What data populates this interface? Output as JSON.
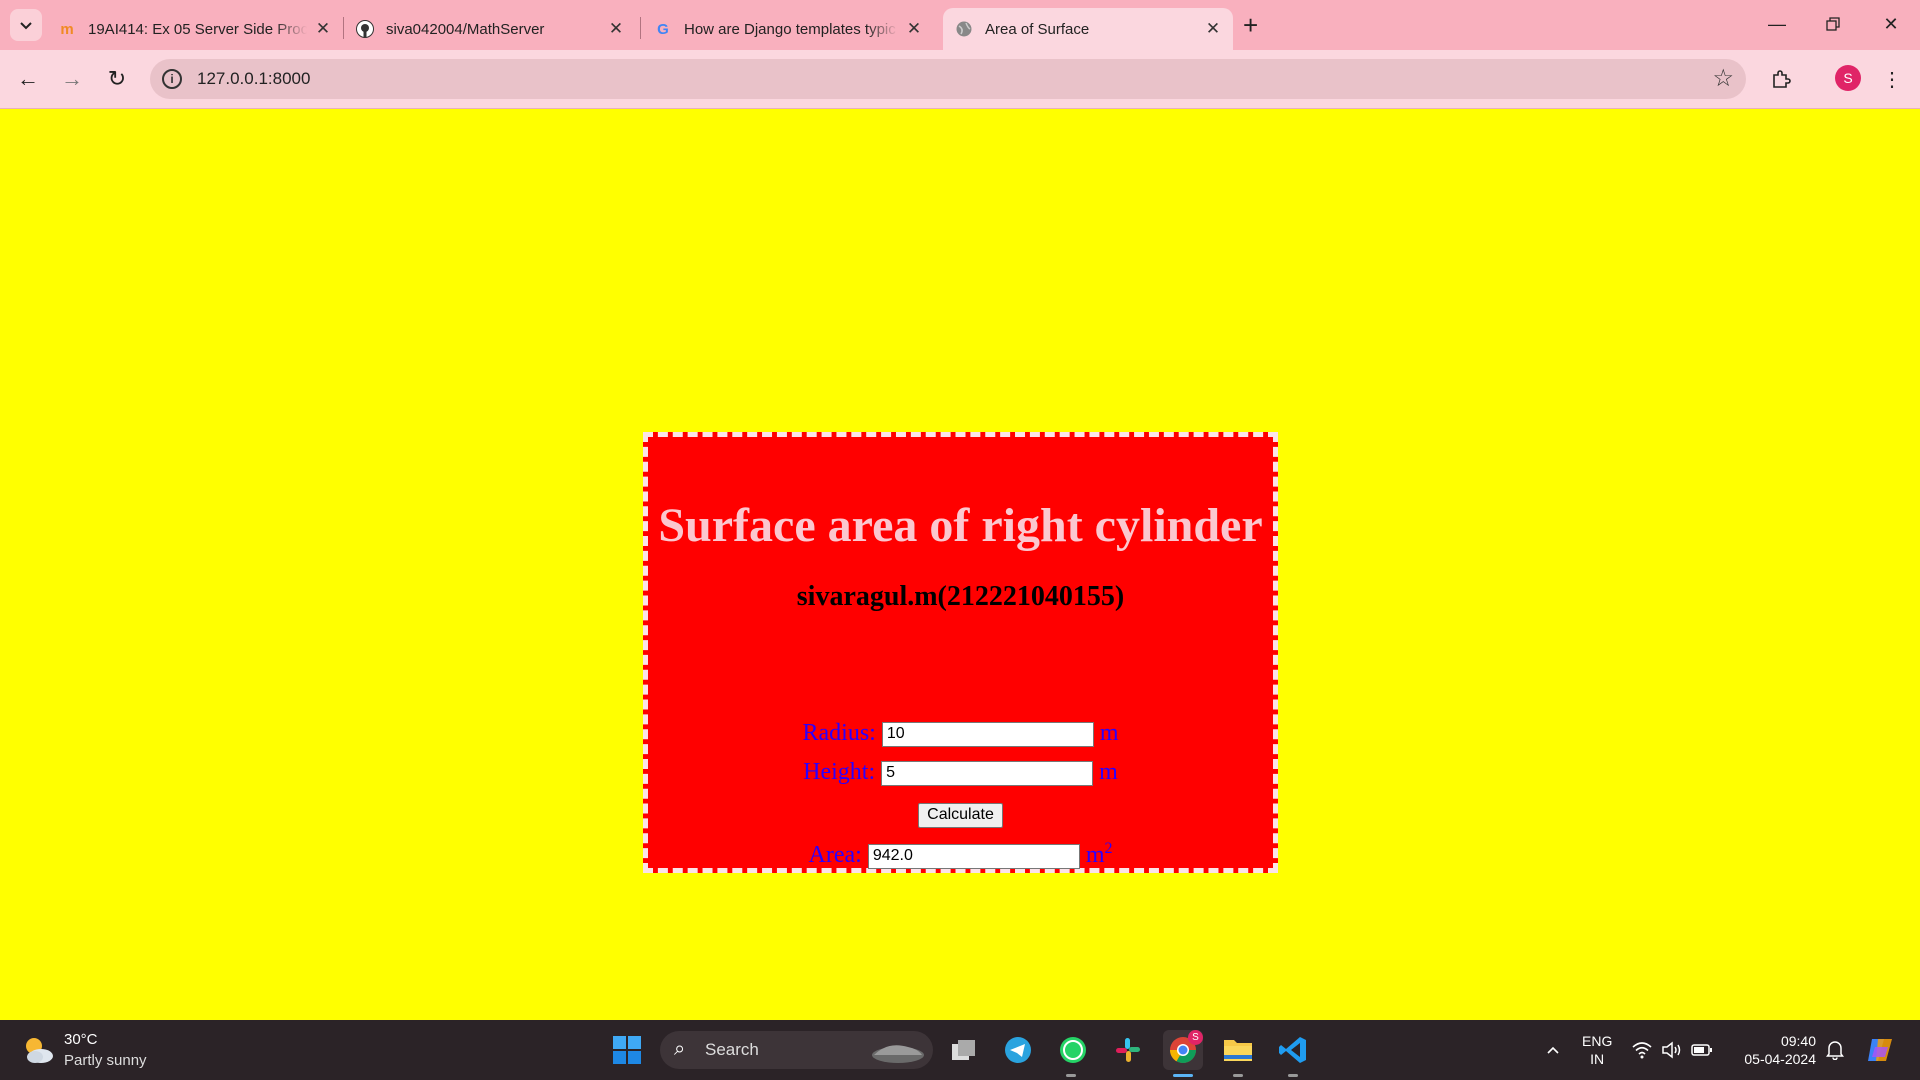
{
  "browser": {
    "tabs": [
      {
        "title": "19AI414: Ex 05 Server Side Proc",
        "icon": "moodle-icon",
        "active": false
      },
      {
        "title": "siva042004/MathServer",
        "icon": "github-icon",
        "active": false
      },
      {
        "title": "How are Django templates typic",
        "icon": "google-icon",
        "active": false
      },
      {
        "title": "Area of Surface",
        "icon": "globe-icon",
        "active": true
      }
    ],
    "url": "127.0.0.1:8000",
    "profile_initial": "S"
  },
  "page": {
    "heading": "Surface area of right cylinder",
    "author": "sivaragul.m(212221040155)",
    "radius_label": "Radius:",
    "radius_value": "10",
    "radius_unit": "m",
    "height_label": "Height:",
    "height_value": "5",
    "height_unit": "m",
    "calculate_label": "Calculate",
    "area_label": "Area:",
    "area_value": "942.0",
    "area_unit": "m",
    "area_unit_exponent": "2",
    "colors": {
      "background": "#ffff00",
      "card": "#ff0000",
      "heading": "#fbc7cf",
      "labels": "#2a00ff"
    }
  },
  "taskbar": {
    "weather_temp": "30°C",
    "weather_desc": "Partly sunny",
    "search_label": "Search",
    "chrome_badge": "S",
    "lang_line1": "ENG",
    "lang_line2": "IN",
    "time": "09:40",
    "date": "05-04-2024"
  }
}
